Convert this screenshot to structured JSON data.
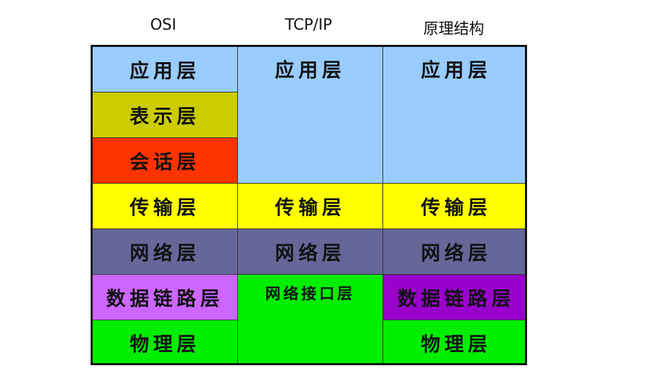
{
  "headers": {
    "osi": "OSI",
    "tcpip": "TCP/IP",
    "principle": "原理结构"
  },
  "osi": {
    "application": "应用层",
    "presentation": "表示层",
    "session": "会话层",
    "transport": "传输层",
    "network": "网络层",
    "datalink": "数据链路层",
    "physical": "物理层"
  },
  "tcpip": {
    "application": "应用层",
    "transport": "传输层",
    "network": "网络层",
    "netinterface": "网络接口层"
  },
  "principle": {
    "application": "应用层",
    "transport": "传输层",
    "network": "网络层",
    "datalink": "数据链路层",
    "physical": "物理层"
  },
  "colors": {
    "application": "#99ccff",
    "presentation": "#cccc00",
    "session": "#ff3300",
    "transport": "#ffff00",
    "network": "#666699",
    "datalink_osi": "#cc66ff",
    "datalink_principle": "#9900cc",
    "physical": "#00ee00"
  }
}
